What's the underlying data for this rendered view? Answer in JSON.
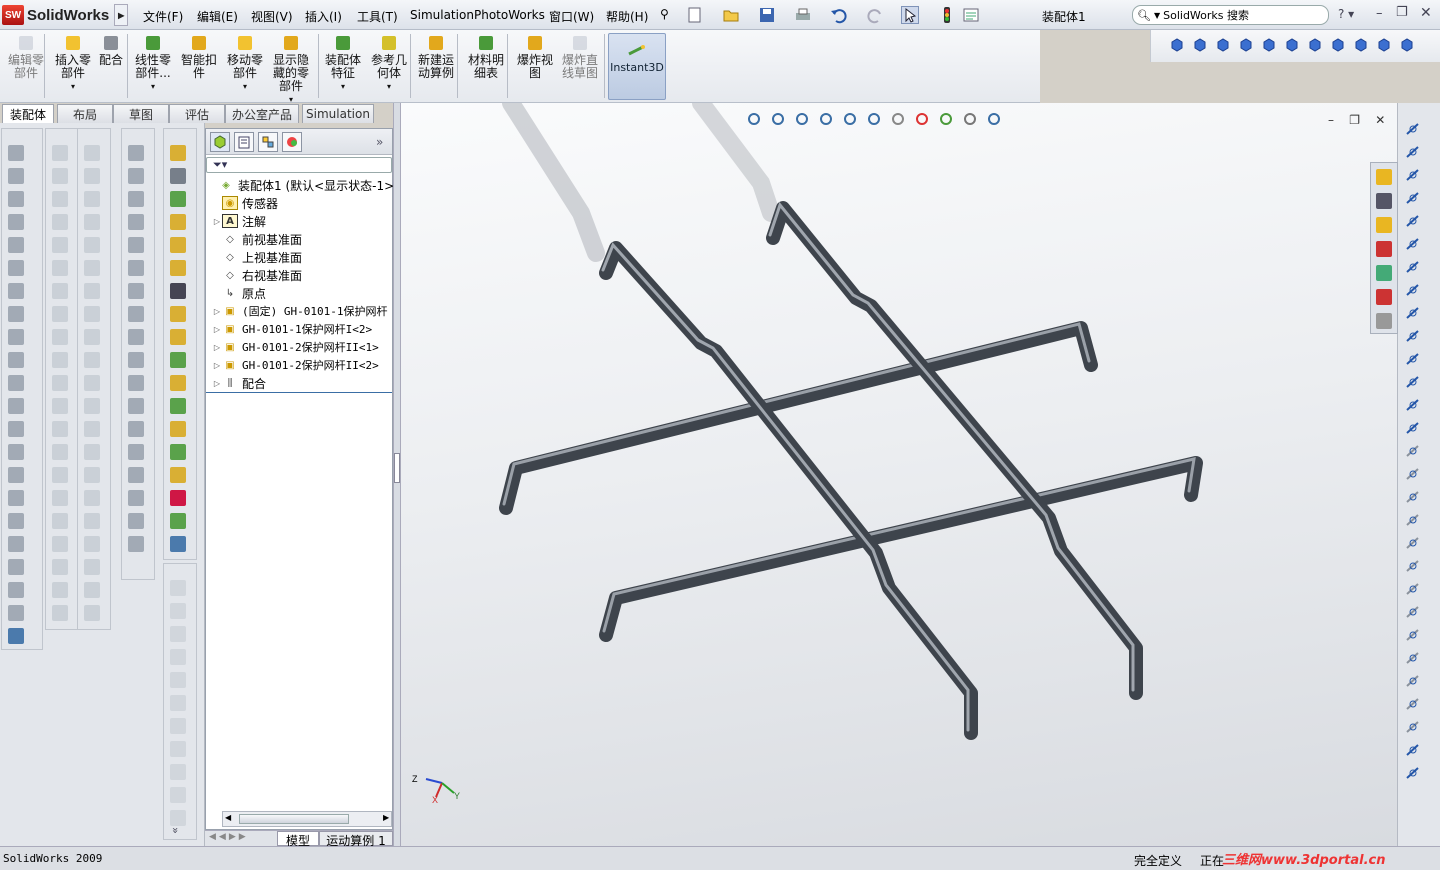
{
  "app": {
    "name": "SolidWorks",
    "document_title": "装配体1"
  },
  "menu": [
    "文件(F)",
    "编辑(E)",
    "视图(V)",
    "插入(I)",
    "工具(T)",
    "Simulation",
    "PhotoWorks",
    "窗口(W)",
    "帮助(H)"
  ],
  "search": {
    "placeholder": "SolidWorks 搜索"
  },
  "command_manager": [
    {
      "label": "编辑零\n部件",
      "icon": "edit-component-icon",
      "enabled": false
    },
    {
      "label": "插入零\n部件",
      "icon": "insert-component-icon",
      "enabled": true
    },
    {
      "label": "配合",
      "icon": "mate-icon",
      "enabled": true
    },
    {
      "label": "线性零\n部件...",
      "icon": "linear-pattern-icon",
      "enabled": true
    },
    {
      "label": "智能扣\n件",
      "icon": "smart-fastener-icon",
      "enabled": true
    },
    {
      "label": "移动零\n部件",
      "icon": "move-component-icon",
      "enabled": true
    },
    {
      "label": "显示隐\n藏的零\n部件",
      "icon": "show-hidden-icon",
      "enabled": true
    },
    {
      "label": "装配体\n特征",
      "icon": "assembly-feature-icon",
      "enabled": true
    },
    {
      "label": "参考几\n何体",
      "icon": "reference-geometry-icon",
      "enabled": true
    },
    {
      "label": "新建运\n动算例",
      "icon": "motion-study-icon",
      "enabled": true
    },
    {
      "label": "材料明\n细表",
      "icon": "bom-icon",
      "enabled": true
    },
    {
      "label": "爆炸视\n图",
      "icon": "exploded-view-icon",
      "enabled": true
    },
    {
      "label": "爆炸直\n线草图",
      "icon": "explode-line-icon",
      "enabled": false
    },
    {
      "label": "Instant3D",
      "icon": "instant3d-icon",
      "enabled": true
    }
  ],
  "tabs": [
    "装配体",
    "布局",
    "草图",
    "评估",
    "办公室产品",
    "Simulation"
  ],
  "active_tab": "装配体",
  "feature_tree": [
    {
      "label": "装配体1  (默认<显示状态-1>)",
      "icon": "assembly-icon",
      "expand": false,
      "indent": 0
    },
    {
      "label": "传感器",
      "icon": "sensor-icon",
      "expand": false,
      "indent": 1
    },
    {
      "label": "注解",
      "icon": "annotation-icon",
      "expand": true,
      "indent": 1
    },
    {
      "label": "前视基准面",
      "icon": "plane-icon",
      "expand": false,
      "indent": 1
    },
    {
      "label": "上视基准面",
      "icon": "plane-icon",
      "expand": false,
      "indent": 1
    },
    {
      "label": "右视基准面",
      "icon": "plane-icon",
      "expand": false,
      "indent": 1
    },
    {
      "label": "原点",
      "icon": "origin-icon",
      "expand": false,
      "indent": 1
    },
    {
      "label": "(固定) GH-0101-1保护网杆",
      "icon": "part-icon",
      "expand": true,
      "indent": 1
    },
    {
      "label": "GH-0101-1保护网杆I<2>",
      "icon": "part-icon",
      "expand": true,
      "indent": 1
    },
    {
      "label": "GH-0101-2保护网杆II<1>",
      "icon": "part-icon",
      "expand": true,
      "indent": 1
    },
    {
      "label": "GH-0101-2保护网杆II<2>",
      "icon": "part-icon",
      "expand": true,
      "indent": 1
    },
    {
      "label": "配合",
      "icon": "mates-folder-icon",
      "expand": true,
      "indent": 1
    }
  ],
  "bottom_tabs": [
    "模型",
    "运动算例 1"
  ],
  "status": {
    "left": "SolidWorks 2009",
    "right1": "完全定义",
    "right2": "正在",
    "watermark": "三维网www.3dportal.cn"
  },
  "colors": {
    "accent": "#3a6ea5",
    "rod": "#4a5058",
    "viewport_top": "#fafbfc",
    "viewport_bottom": "#d8dbe0"
  }
}
